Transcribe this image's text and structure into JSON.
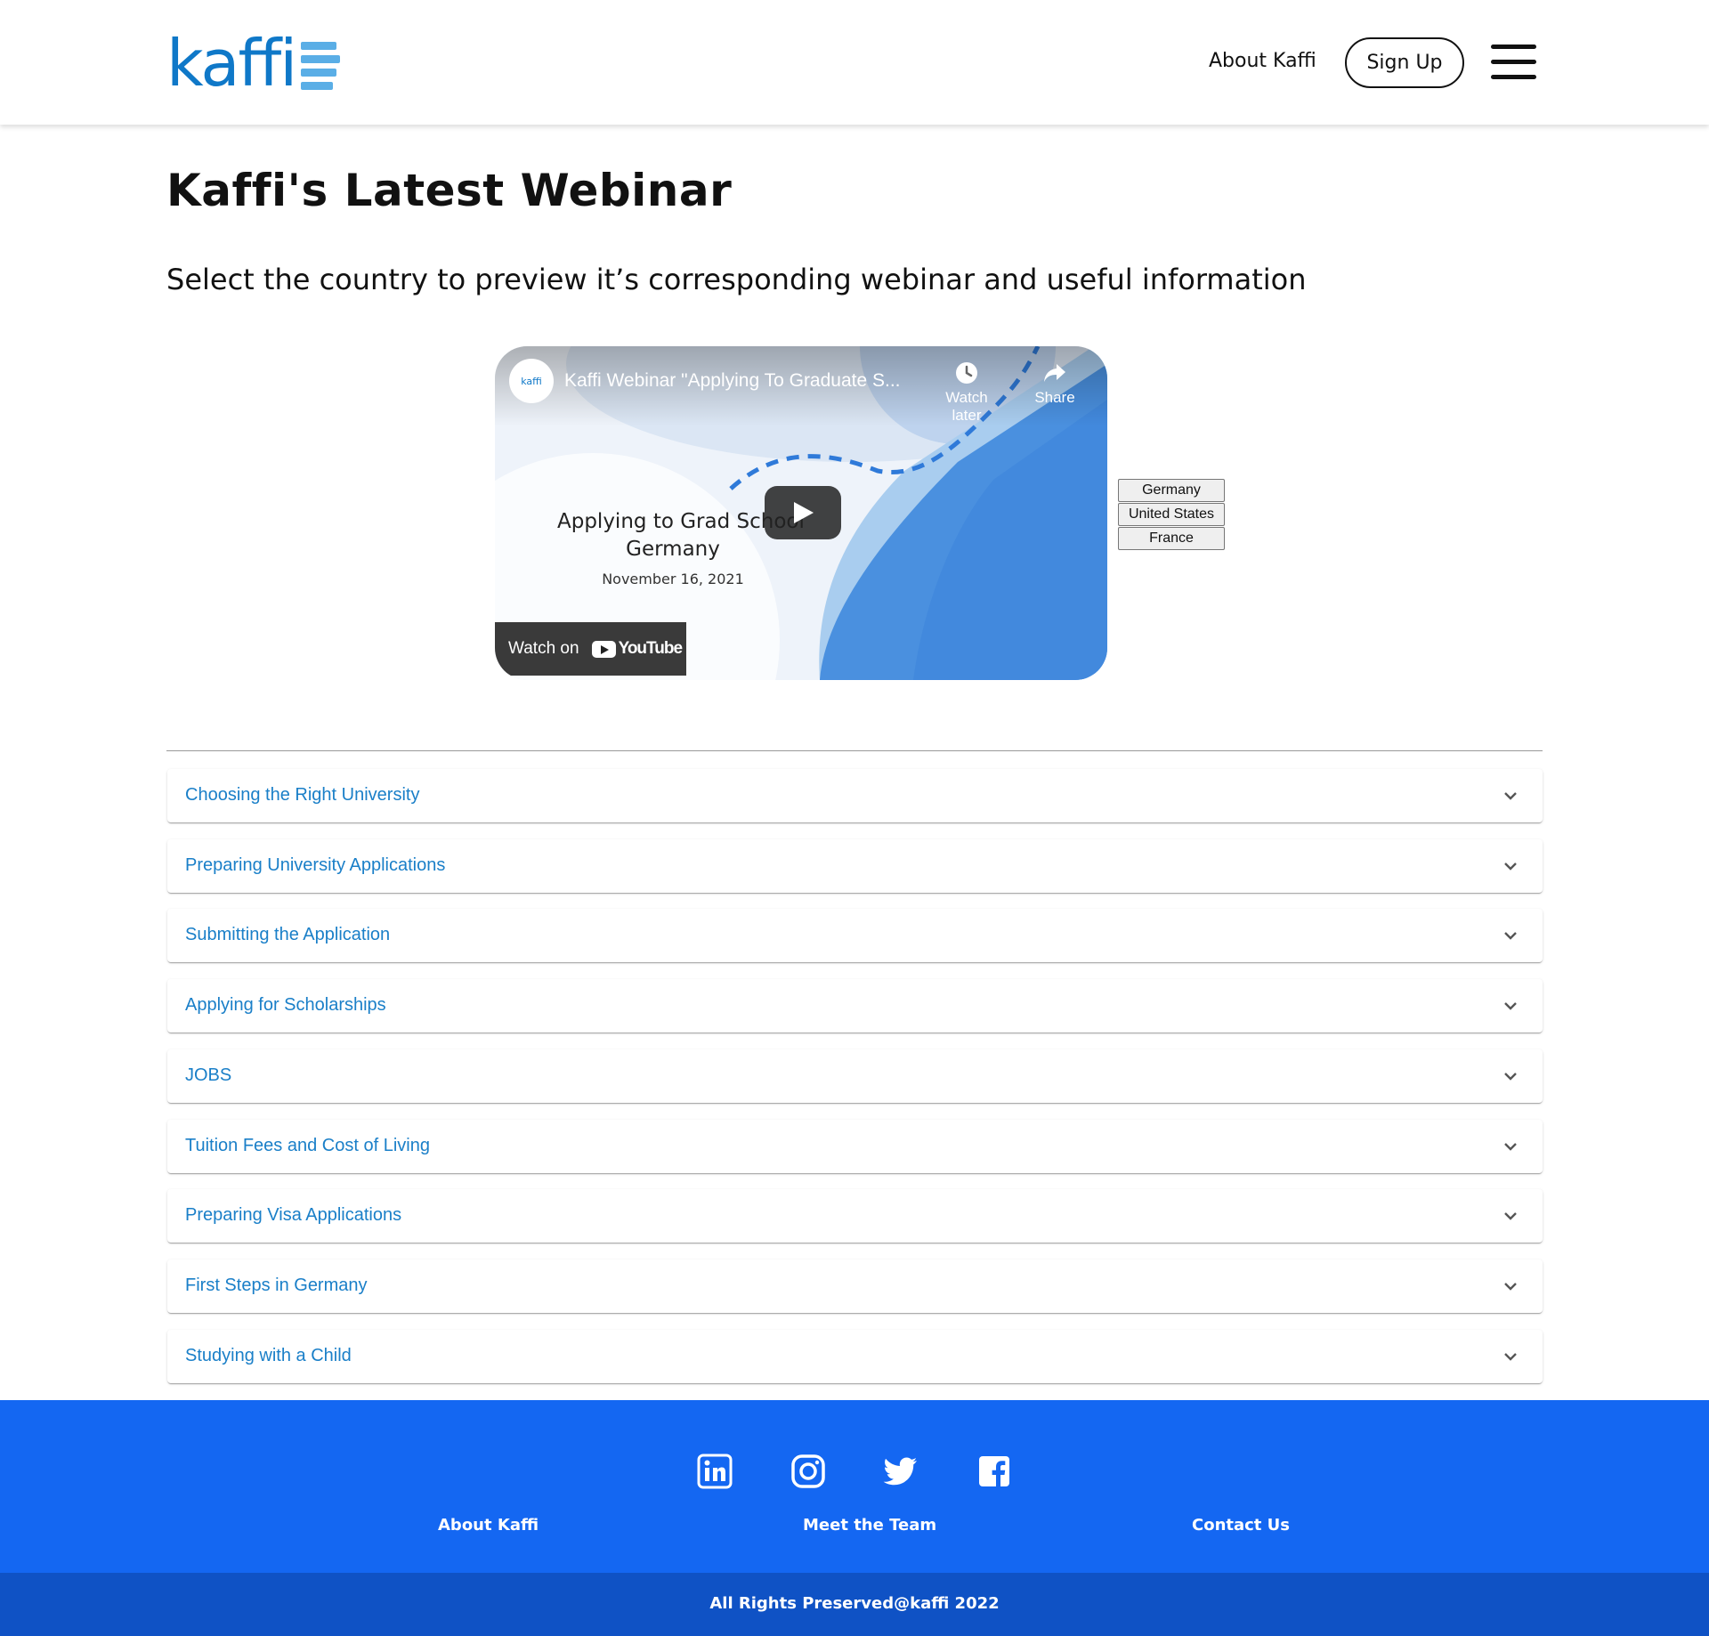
{
  "header": {
    "logo_text": "kaffi",
    "nav_about": "About Kaffi",
    "signup_label": "Sign Up",
    "menu_icon": "hamburger-menu-icon"
  },
  "main": {
    "title": "Kaffi's Latest Webinar",
    "subtitle": "Select the country to preview it’s corresponding webinar and useful information"
  },
  "video": {
    "channel": "kaffi",
    "title": "Kaffi Webinar \"Applying To Graduate S...",
    "watch_later": "Watch later",
    "share": "Share",
    "slide_line1": "Applying to Grad School",
    "slide_line2": "Germany",
    "slide_date": "November 16, 2021",
    "watch_on": "Watch on",
    "youtube": "YouTube"
  },
  "countries": [
    "Germany",
    "United States",
    "France"
  ],
  "accordion": [
    "Choosing the Right University",
    "Preparing University Applications",
    "Submitting the Application",
    "Applying for Scholarships",
    "JOBS",
    "Tuition Fees and Cost of Living",
    "Preparing Visa Applications",
    "First Steps in Germany",
    "Studying with a Child"
  ],
  "footer": {
    "social_icons": [
      "linkedin-icon",
      "instagram-icon",
      "twitter-icon",
      "facebook-icon"
    ],
    "links": [
      "About Kaffi",
      "Meet the Team",
      "Contact Us"
    ],
    "copyright": "All Rights Preserved@kaffi 2022"
  },
  "colors": {
    "brand_blue": "#0f78c8",
    "accordion_text": "#1a7fc8",
    "footer_bg": "#1467f2",
    "copyright_bg": "#0f52c5"
  }
}
